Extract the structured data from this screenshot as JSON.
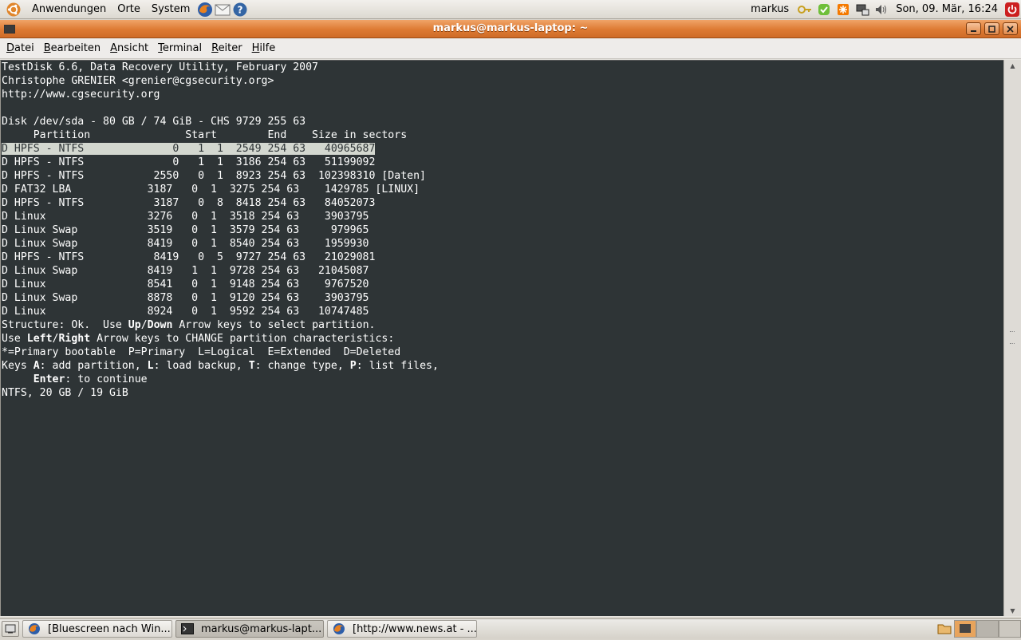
{
  "top_panel": {
    "menus": [
      "Anwendungen",
      "Orte",
      "System"
    ],
    "user": "markus",
    "clock": "Son, 09. Mär, 16:24"
  },
  "window": {
    "title": "markus@markus-laptop: ~",
    "menu": [
      {
        "mnemonic": "D",
        "rest": "atei"
      },
      {
        "mnemonic": "B",
        "rest": "earbeiten"
      },
      {
        "mnemonic": "A",
        "rest": "nsicht"
      },
      {
        "mnemonic": "T",
        "rest": "erminal"
      },
      {
        "mnemonic": "R",
        "rest": "eiter"
      },
      {
        "mnemonic": "H",
        "rest": "ilfe"
      }
    ]
  },
  "terminal": {
    "header": [
      "TestDisk 6.6, Data Recovery Utility, February 2007",
      "Christophe GRENIER <grenier@cgsecurity.org>",
      "http://www.cgsecurity.org",
      "",
      "Disk /dev/sda - 80 GB / 74 GiB - CHS 9729 255 63",
      "     Partition               Start        End    Size in sectors"
    ],
    "partitions": [
      "D HPFS - NTFS              0   1  1  2549 254 63   40965687",
      "D HPFS - NTFS              0   1  1  3186 254 63   51199092",
      "D HPFS - NTFS           2550   0  1  8923 254 63  102398310 [Daten]",
      "D FAT32 LBA            3187   0  1  3275 254 63    1429785 [LINUX]",
      "D HPFS - NTFS           3187   0  8  8418 254 63   84052073",
      "D Linux                3276   0  1  3518 254 63    3903795",
      "D Linux Swap           3519   0  1  3579 254 63     979965",
      "D Linux Swap           8419   0  1  8540 254 63    1959930",
      "D HPFS - NTFS           8419   0  5  9727 254 63   21029081",
      "D Linux Swap           8419   1  1  9728 254 63   21045087",
      "D Linux                8541   0  1  9148 254 63    9767520",
      "D Linux Swap           8878   0  1  9120 254 63    3903795",
      "D Linux                8924   0  1  9592 254 63   10747485"
    ],
    "selected_index": 0,
    "help": {
      "l1_a": "Structure: Ok.  Use ",
      "l1_up": "Up",
      "l1_slash": "/",
      "l1_down": "Down",
      "l1_b": " Arrow keys to select partition.",
      "l2_a": "Use ",
      "l2_left": "Left",
      "l2_slash": "/",
      "l2_right": "Right",
      "l2_b": " Arrow keys to CHANGE partition characteristics:",
      "l3": "*=Primary bootable  P=Primary  L=Logical  E=Extended  D=Deleted",
      "l4_a": "Keys ",
      "l4_A": "A",
      "l4_b": ": add partition, ",
      "l4_L": "L",
      "l4_c": ": load backup, ",
      "l4_T": "T",
      "l4_d": ": change type, ",
      "l4_P": "P",
      "l4_e": ": list files,",
      "l5_indent": "     ",
      "l5_enter": "Enter",
      "l5_b": ": to continue",
      "l6": "NTFS, 20 GB / 19 GiB"
    }
  },
  "taskbar": {
    "tasks": [
      {
        "label": "[Bluescreen nach Win...",
        "icon": "firefox-icon",
        "active": false
      },
      {
        "label": "markus@markus-lapt...",
        "icon": "terminal-icon",
        "active": true
      },
      {
        "label": "[http://www.news.at - ...",
        "icon": "firefox-icon",
        "active": false
      }
    ]
  }
}
